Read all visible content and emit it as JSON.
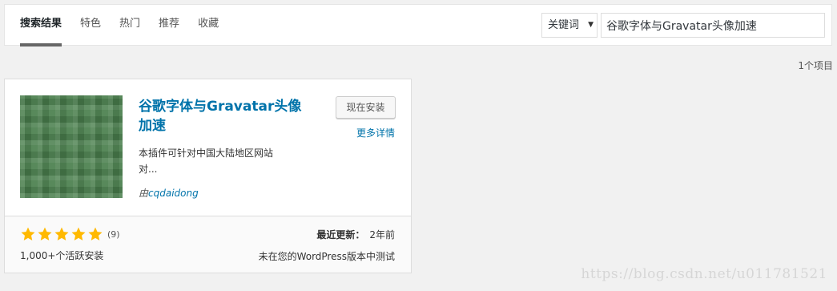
{
  "tabs": [
    {
      "label": "搜索结果",
      "active": true
    },
    {
      "label": "特色",
      "active": false
    },
    {
      "label": "热门",
      "active": false
    },
    {
      "label": "推荐",
      "active": false
    },
    {
      "label": "收藏",
      "active": false
    }
  ],
  "search": {
    "type_selected": "关键词",
    "query": "谷歌字体与Gravatar头像加速"
  },
  "results_count": "1个项目",
  "plugin": {
    "title_line1": "谷歌字体与Gravatar头像",
    "title_line2": "加速",
    "description_line1": "本插件可针对中国大陆地区网站",
    "description_line2": "对...",
    "author_prefix": "由",
    "author": "cqdaidong",
    "install_label": "现在安装",
    "details_label": "更多详情",
    "rating_stars": 5,
    "rating_count": "(9)",
    "active_installs": "1,000+个活跃安装",
    "last_updated_label": "最近更新：",
    "last_updated_value": "2年前",
    "compatibility": "未在您的WordPress版本中测试"
  },
  "watermark": "https://blog.csdn.net/u011781521",
  "colors": {
    "accent": "#0073aa",
    "star": "#ffb900",
    "thumb_green": "#4a7f4d"
  }
}
